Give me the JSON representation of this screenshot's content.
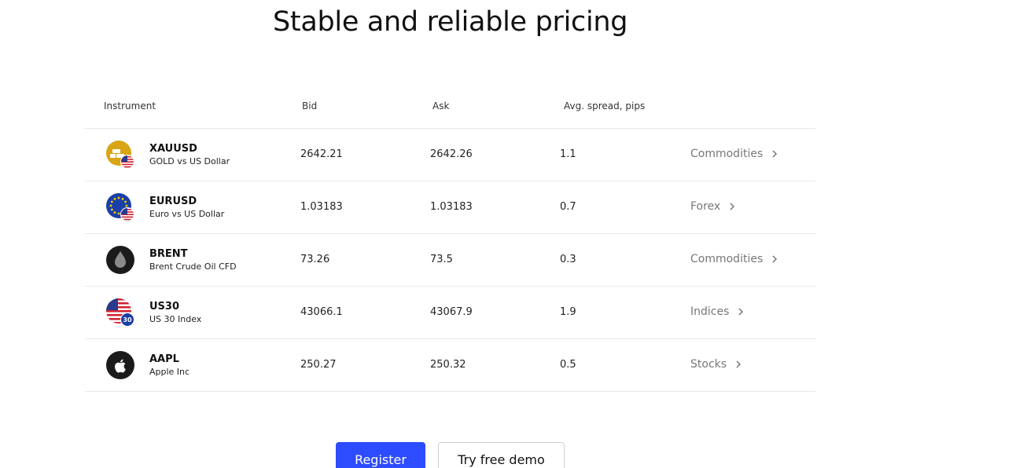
{
  "title": "Stable and reliable pricing",
  "columns": {
    "instrument": "Instrument",
    "bid": "Bid",
    "ask": "Ask",
    "spread": "Avg. spread, pips"
  },
  "rows": [
    {
      "symbol": "XAUUSD",
      "name": "GOLD vs US Dollar",
      "bid": "2642.21",
      "ask": "2642.26",
      "spread": "1.1",
      "category": "Commodities",
      "icon": "gold-icon"
    },
    {
      "symbol": "EURUSD",
      "name": "Euro vs US Dollar",
      "bid": "1.03183",
      "ask": "1.03183",
      "spread": "0.7",
      "category": "Forex",
      "icon": "eu-flag-icon"
    },
    {
      "symbol": "BRENT",
      "name": "Brent Crude Oil CFD",
      "bid": "73.26",
      "ask": "73.5",
      "spread": "0.3",
      "category": "Commodities",
      "icon": "oil-drop-icon"
    },
    {
      "symbol": "US30",
      "name": "US 30 Index",
      "bid": "43066.1",
      "ask": "43067.9",
      "spread": "1.9",
      "category": "Indices",
      "icon": "us-flag-icon",
      "badge": "30"
    },
    {
      "symbol": "AAPL",
      "name": "Apple Inc",
      "bid": "250.27",
      "ask": "250.32",
      "spread": "0.5",
      "category": "Stocks",
      "icon": "apple-logo-icon"
    }
  ],
  "buttons": {
    "register": "Register",
    "demo": "Try free demo"
  },
  "colors": {
    "accent": "#2d4bff",
    "gold": "#d9a514",
    "eu_blue": "#1a3fa8",
    "dark": "#1b1b1b"
  }
}
